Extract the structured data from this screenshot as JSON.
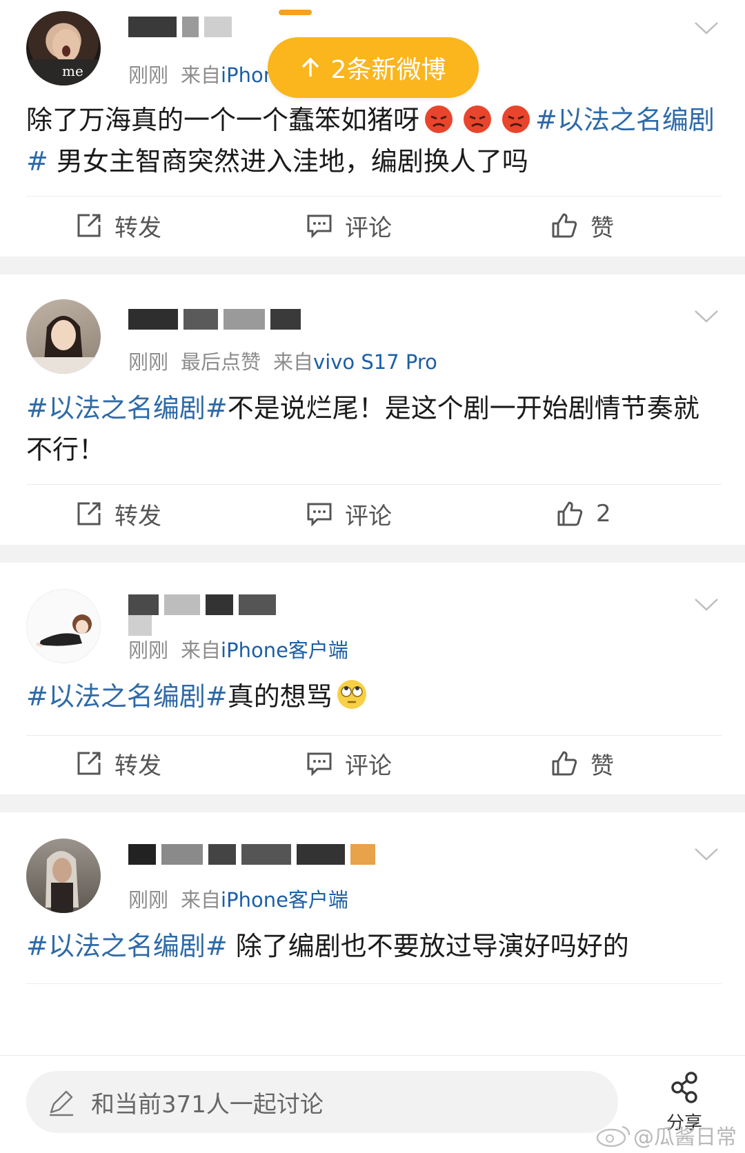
{
  "new_posts_banner": {
    "label": "2条新微博"
  },
  "posts": [
    {
      "time": "刚刚",
      "source_prefix": "来自",
      "source": "iPhone客户端",
      "content_plain": "除了万海真的一个一个蠢笨如猪呀",
      "hashtag": "#以法之名编剧#",
      "content_after": " 男女主智商突然进入洼地，编剧换人了吗",
      "repost": "转发",
      "comment": "评论",
      "like": "赞"
    },
    {
      "time": "刚刚",
      "extra": "最后点赞",
      "source_prefix": "来自",
      "source": "vivo S17 Pro",
      "hashtag": "#以法之名编剧#",
      "content_after": "不是说烂尾！是这个剧一开始剧情节奏就不行！",
      "repost": "转发",
      "comment": "评论",
      "like": "2"
    },
    {
      "time": "刚刚",
      "source_prefix": "来自",
      "source": "iPhone客户端",
      "hashtag": "#以法之名编剧#",
      "content_after": "真的想骂",
      "repost": "转发",
      "comment": "评论",
      "like": "赞"
    },
    {
      "time": "刚刚",
      "source_prefix": "来自",
      "source": "iPhone客户端",
      "hashtag": "#以法之名编剧#",
      "content_after": " 除了编剧也不要放过导演好吗好的"
    }
  ],
  "bottom_bar": {
    "placeholder": "和当前371人一起讨论",
    "share": "分享"
  },
  "watermark": "@瓜酱日常",
  "colors": {
    "accent": "#fbb51d",
    "link": "#2e6aa8",
    "source": "#1b5fa6"
  }
}
